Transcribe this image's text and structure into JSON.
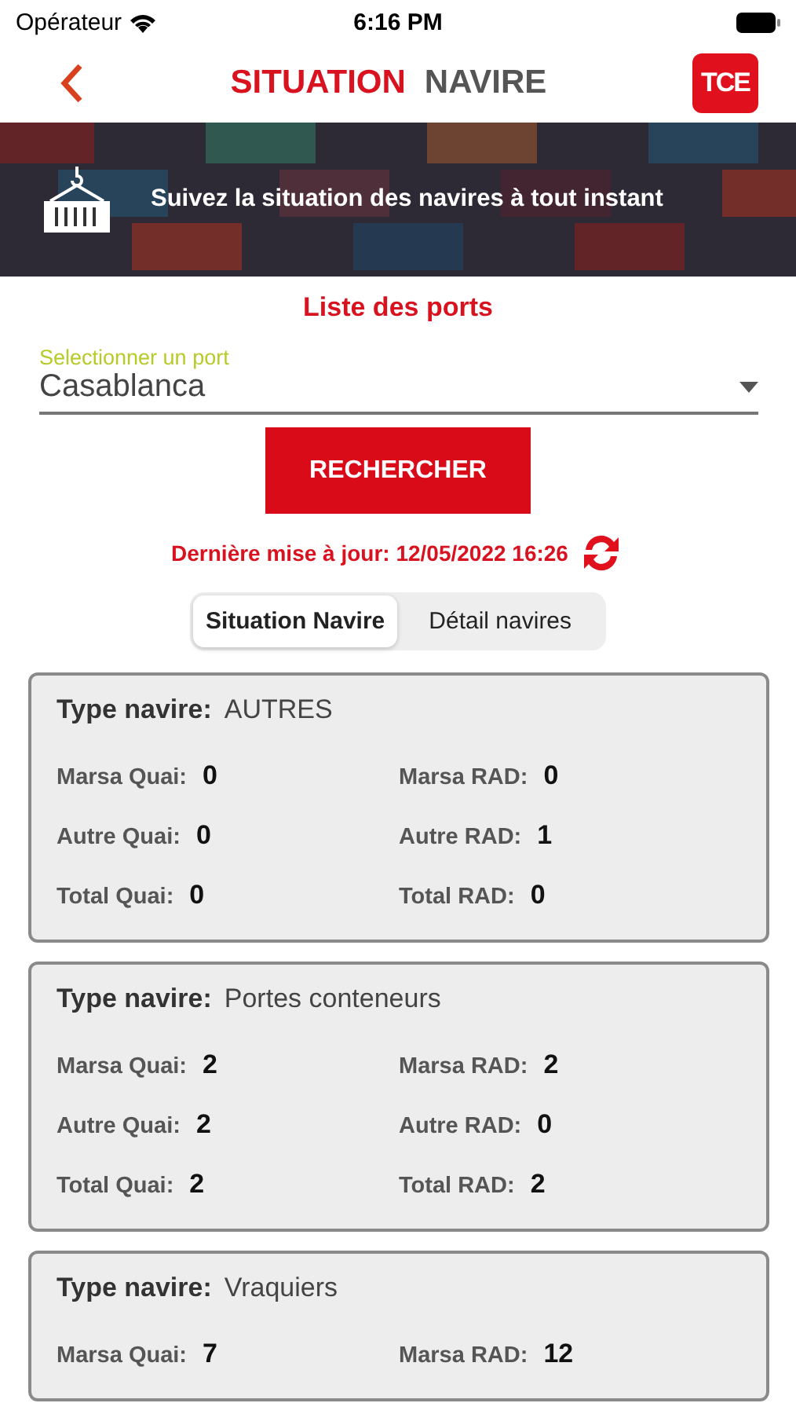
{
  "status_bar": {
    "carrier": "Opérateur",
    "time": "6:16 PM"
  },
  "header": {
    "title_parts": [
      {
        "text": "SITUATION",
        "kind": "accent"
      },
      {
        "text": "NAVIRE",
        "kind": "muted"
      }
    ],
    "logo": "TCE"
  },
  "banner": {
    "kind": "picture",
    "text": "Suivez la situation des navires à tout instant"
  },
  "ports": {
    "title": "Liste des ports",
    "placeholder": "Selectionner un port",
    "value": "Casablanca",
    "button": "RECHERCHER",
    "updated": "Dernière mise à jour: 12/05/2022 16:26"
  },
  "tabs": [
    {
      "label": "Situation Navire",
      "selected": true
    },
    {
      "label": "Détail navires",
      "selected": false
    }
  ],
  "cards": [
    {
      "type_label": "Type navire:",
      "type_value": "AUTRES",
      "rows": [
        [
          {
            "label": "Marsa Quai:",
            "value": "0"
          },
          {
            "label": "Marsa RAD:",
            "value": "0"
          }
        ],
        [
          {
            "label": "Autre Quai:",
            "value": "0"
          },
          {
            "label": "Autre RAD:",
            "value": "1"
          }
        ],
        [
          {
            "label": "Total Quai:",
            "value": "0"
          },
          {
            "label": "Total RAD:",
            "value": "0"
          }
        ]
      ]
    },
    {
      "type_label": "Type navire:",
      "type_value": "Portes conteneurs",
      "rows": [
        [
          {
            "label": "Marsa Quai:",
            "value": "2"
          },
          {
            "label": "Marsa RAD:",
            "value": "2"
          }
        ],
        [
          {
            "label": "Autre Quai:",
            "value": "2"
          },
          {
            "label": "Autre RAD:",
            "value": "0"
          }
        ],
        [
          {
            "label": "Total Quai:",
            "value": "2"
          },
          {
            "label": "Total RAD:",
            "value": "2"
          }
        ]
      ]
    },
    {
      "type_label": "Type navire:",
      "type_value": "Vraquiers",
      "rows": [
        [
          {
            "label": "Marsa Quai:",
            "value": "7"
          },
          {
            "label": "Marsa RAD:",
            "value": "12"
          }
        ]
      ]
    }
  ]
}
